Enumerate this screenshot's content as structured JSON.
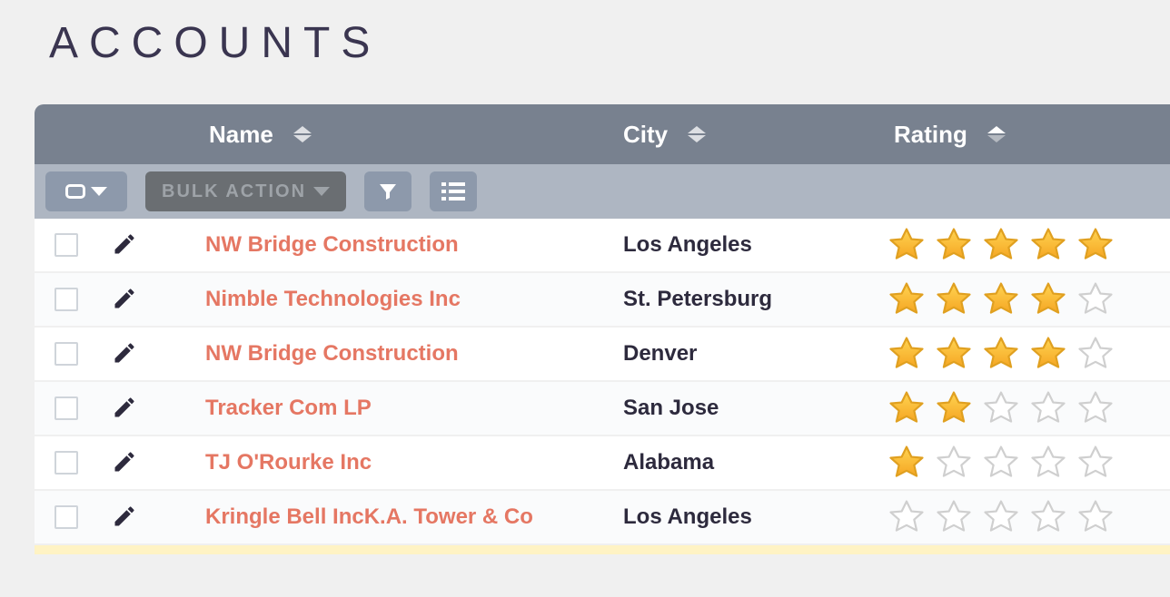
{
  "page": {
    "title": "ACCOUNTS"
  },
  "columns": {
    "name": "Name",
    "city": "City",
    "rating": "Rating"
  },
  "toolbar": {
    "bulk_action": "BULK ACTION"
  },
  "rows": [
    {
      "name": "NW Bridge Construction",
      "city": "Los Angeles",
      "rating": 5
    },
    {
      "name": "Nimble Technologies Inc",
      "city": "St. Petersburg",
      "rating": 4
    },
    {
      "name": "NW Bridge Construction",
      "city": "Denver",
      "rating": 4
    },
    {
      "name": "Tracker Com LP",
      "city": "San Jose",
      "rating": 2
    },
    {
      "name": "TJ O'Rourke Inc",
      "city": "Alabama",
      "rating": 1
    },
    {
      "name": "Kringle Bell IncK.A. Tower & Co",
      "city": "Los Angeles",
      "rating": 0
    }
  ]
}
